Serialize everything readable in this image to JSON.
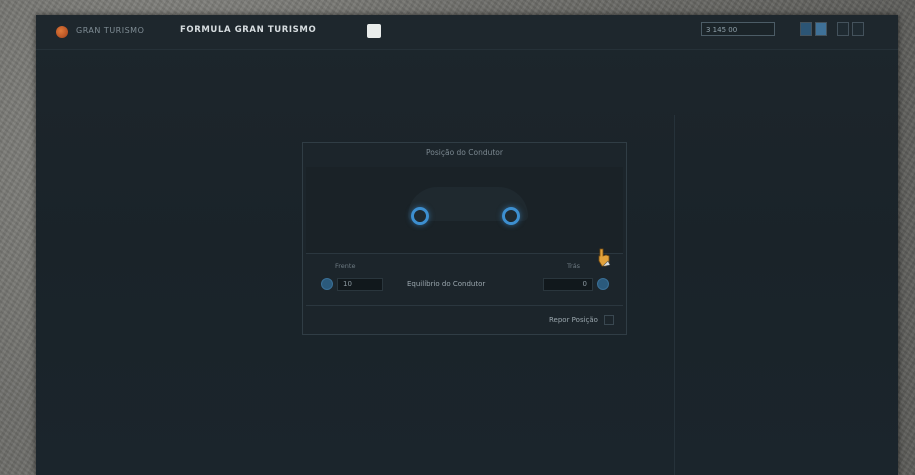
{
  "window": {
    "title_prefix": "GRAN TURISMO",
    "title_main": "FORMULA GRAN TURISMO",
    "status": "3 145 00",
    "icon": "app-icon"
  },
  "dialog": {
    "title": "Posição do Condutor",
    "left_label": "Frente",
    "right_label": "Trás",
    "center_label": "Equilíbrio do Condutor",
    "left_value": "10",
    "right_value": "0",
    "reset_label": "Repor Posição"
  },
  "colors": {
    "accent": "#3d8fd0",
    "background": "#1b252c"
  },
  "icons": {
    "cursor": "hand-cursor-icon",
    "minus": "minus-icon",
    "plus": "plus-icon"
  }
}
